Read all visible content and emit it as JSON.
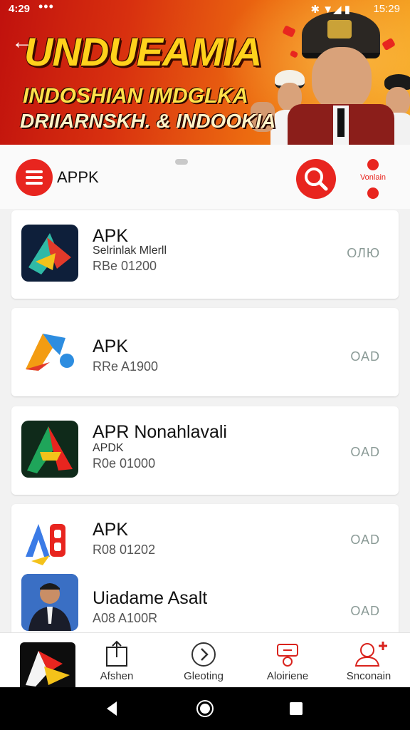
{
  "status_bar": {
    "time": "4:29",
    "dots": "•••",
    "icons": "✱ ▼◢ ▮",
    "right_time": "15:29"
  },
  "banner": {
    "title": "UNDUEAMIA",
    "subtitle_line1": "INDOSHIAN IMDGLKA",
    "subtitle_line2": "DRIIARNSKH. & INDOOKIA"
  },
  "search_bar": {
    "label": "APPK",
    "account_label": "Vonlain"
  },
  "apps": [
    {
      "title": "APK",
      "subtitle": "Selrinlak Mlerll",
      "meta": "RBe 01200",
      "action": "ОЛЮ"
    },
    {
      "title": "APK",
      "subtitle": "",
      "meta": "RRe A1900",
      "action": "ОАD"
    },
    {
      "title": "APR Nonahlavali",
      "subtitle": "APDK",
      "meta": "R0e 01000",
      "action": "ОАD"
    },
    {
      "title": "APK",
      "subtitle": "",
      "meta": "R08 01202",
      "action": "ОАD"
    },
    {
      "title": "Uiadame Asalt",
      "subtitle": "",
      "meta": "A08 A100R",
      "action": "ОАD"
    }
  ],
  "bottom_nav": [
    {
      "label": "Afshen",
      "icon": "share-icon"
    },
    {
      "label": "Gleoting",
      "icon": "play-circle-icon"
    },
    {
      "label": "Aloiriene",
      "icon": "alarm-icon"
    },
    {
      "label": "Snconain",
      "icon": "add-user-icon"
    }
  ],
  "colors": {
    "accent": "#e8251f",
    "banner_yellow": "#ffd21c"
  }
}
